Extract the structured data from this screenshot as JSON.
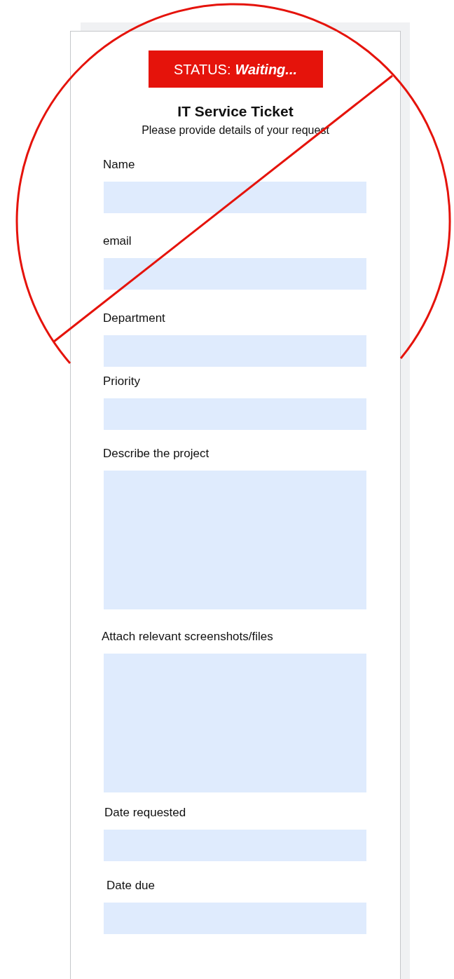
{
  "status": {
    "label": "STATUS:",
    "value": "Waiting..."
  },
  "title": "IT Service Ticket",
  "subtitle": "Please provide details of your request",
  "fields": [
    {
      "label": "Name",
      "kind": "text"
    },
    {
      "label": "email",
      "kind": "text"
    },
    {
      "label": "Department",
      "kind": "text"
    },
    {
      "label": "Priority",
      "kind": "text"
    },
    {
      "label": "Describe the project",
      "kind": "textarea"
    },
    {
      "label": "Attach relevant screenshots/files",
      "kind": "textarea"
    },
    {
      "label": "Date requested",
      "kind": "text"
    },
    {
      "label": "Date due",
      "kind": "text"
    }
  ]
}
